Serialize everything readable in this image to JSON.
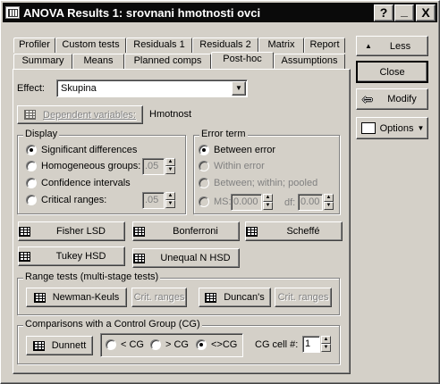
{
  "window": {
    "title": "ANOVA Results 1: srovnani hmotnosti ovci",
    "help": "?",
    "minimize": "_",
    "close": "X"
  },
  "tabs_top": [
    "Profiler",
    "Custom tests",
    "Residuals 1",
    "Residuals 2",
    "Matrix",
    "Report"
  ],
  "tabs_bottom": [
    "Summary",
    "Means",
    "Planned comps",
    "Post-hoc",
    "Assumptions"
  ],
  "effect": {
    "label": "Effect:",
    "value": "Skupina"
  },
  "dependent": {
    "button": "Dependent variables:",
    "value": "Hmotnost"
  },
  "display": {
    "title": "Display",
    "options": [
      "Significant differences",
      "Homogeneous groups:",
      "Confidence intervals",
      "Critical ranges:"
    ],
    "homog_value": ".05",
    "critical_value": ".05"
  },
  "error_term": {
    "title": "Error term",
    "options": [
      "Between error",
      "Within error",
      "Between; within; pooled"
    ],
    "ms_label": "MS:",
    "ms_value": "0.000",
    "df_label": "df:",
    "df_value": "0.00"
  },
  "tests": {
    "fisher": "Fisher LSD",
    "bonferroni": "Bonferroni",
    "scheffe": "Scheffé",
    "tukey": "Tukey HSD",
    "unequal": "Unequal N HSD"
  },
  "range": {
    "title": "Range tests (multi-stage tests)",
    "newman": "Newman-Keuls",
    "crit1": "Crit. ranges",
    "duncan": "Duncan's",
    "crit2": "Crit. ranges"
  },
  "control": {
    "title": "Comparisons with a Control Group (CG)",
    "dunnett": "Dunnett",
    "opt1": "< CG",
    "opt2": "> CG",
    "opt3": "<>CG",
    "cell_label": "CG cell #:",
    "cell_value": "1"
  },
  "side": {
    "less": "Less",
    "close": "Close",
    "modify": "Modify",
    "options": "Options"
  }
}
